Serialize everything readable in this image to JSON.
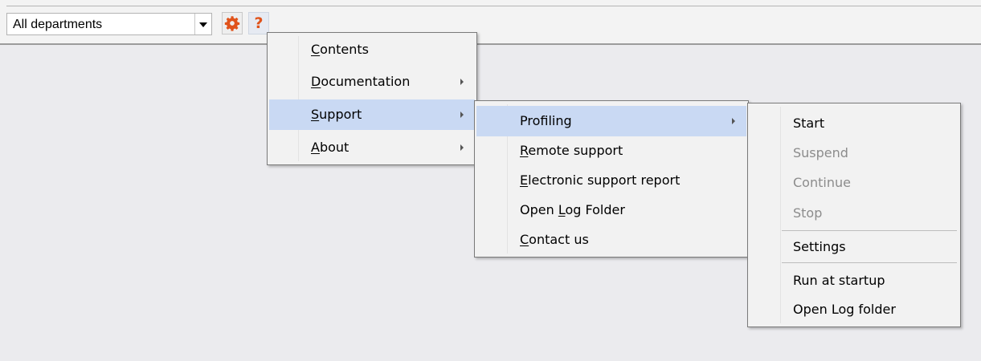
{
  "toolbar": {
    "department_value": "All departments",
    "settings_icon": "gear-icon",
    "help_icon": "help-icon",
    "help_glyph": "?",
    "accent_color": "#e0531b"
  },
  "help_menu": {
    "items": [
      {
        "pre": "",
        "mn": "C",
        "post": "ontents",
        "submenu": false
      },
      {
        "pre": "",
        "mn": "D",
        "post": "ocumentation",
        "submenu": true
      },
      {
        "pre": "",
        "mn": "S",
        "post": "upport",
        "submenu": true,
        "highlighted": true
      },
      {
        "pre": "",
        "mn": "A",
        "post": "bout",
        "submenu": true
      }
    ]
  },
  "support_menu": {
    "items": [
      {
        "pre": "Profiling",
        "mn": "",
        "post": "",
        "submenu": true,
        "highlighted": true
      },
      {
        "pre": "",
        "mn": "R",
        "post": "emote support"
      },
      {
        "pre": "",
        "mn": "E",
        "post": "lectronic support report"
      },
      {
        "pre": "Open ",
        "mn": "L",
        "post": "og Folder"
      },
      {
        "pre": "",
        "mn": "C",
        "post": "ontact us"
      }
    ]
  },
  "profiling_menu": {
    "items": [
      {
        "label": "Start",
        "enabled": true
      },
      {
        "label": "Suspend",
        "enabled": false
      },
      {
        "label": "Continue",
        "enabled": false
      },
      {
        "label": "Stop",
        "enabled": false
      },
      {
        "label": "Settings",
        "enabled": true
      },
      {
        "label": "Run at startup",
        "enabled": true
      },
      {
        "label": "Open Log folder",
        "enabled": true
      }
    ]
  }
}
